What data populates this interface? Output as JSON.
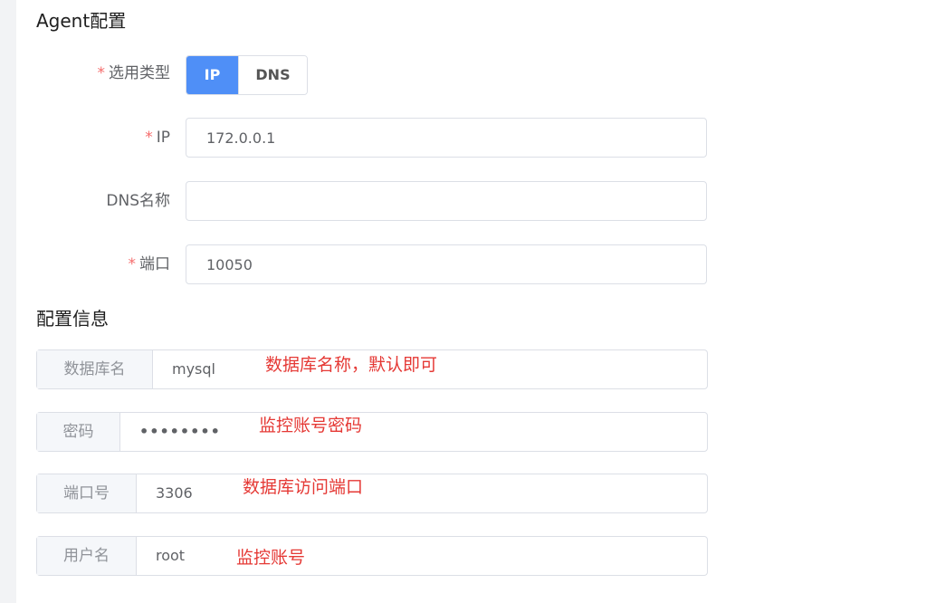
{
  "agent_section": {
    "title": "Agent配置",
    "type_label": "选用类型",
    "type_options": [
      "IP",
      "DNS"
    ],
    "type_selected": "IP",
    "ip_label": "IP",
    "ip_value": "172.0.0.1",
    "dns_label": "DNS名称",
    "dns_value": "",
    "port_label": "端口",
    "port_value": "10050",
    "required_mark": "*"
  },
  "config_section": {
    "title": "配置信息",
    "fields": [
      {
        "label": "数据库名",
        "value": "mysql",
        "note": "数据库名称，默认即可"
      },
      {
        "label": "密码",
        "value": "••••••••",
        "note": "监控账号密码"
      },
      {
        "label": "端口号",
        "value": "3306",
        "note": "数据库访问端口"
      },
      {
        "label": "用户名",
        "value": "root",
        "note": "监控账号"
      }
    ]
  },
  "colors": {
    "primary": "#4f8ff7",
    "required": "#f56c6c",
    "annotation": "#e53935",
    "border": "#dcdfe6"
  }
}
